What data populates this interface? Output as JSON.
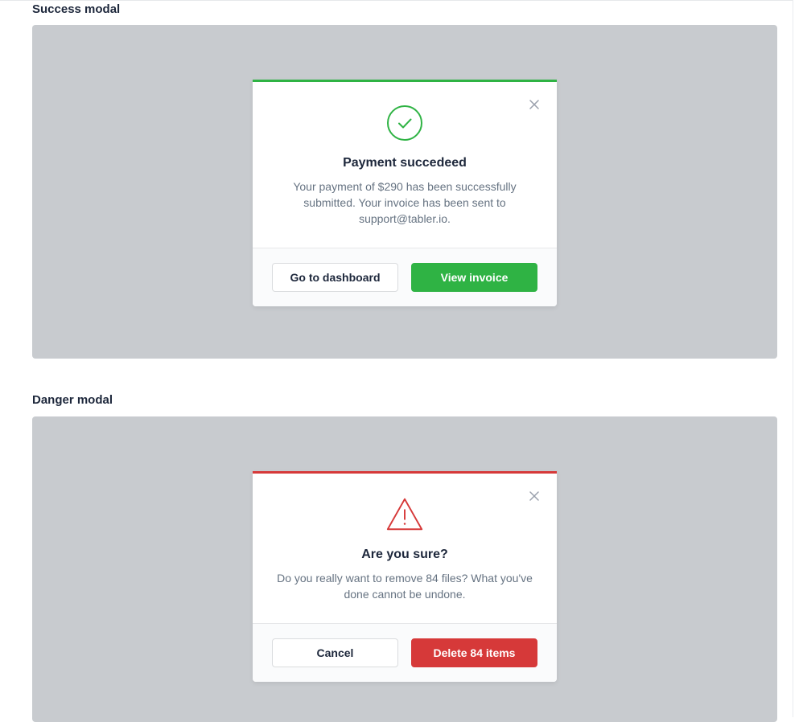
{
  "success_section": {
    "title": "Success modal",
    "modal": {
      "accent_color": "#2fb344",
      "icon": "circle-check-icon",
      "close_icon": "close-icon",
      "title": "Payment succedeed",
      "text": "Your payment of $290 has been successfully submitted. Your invoice has been sent to support@tabler.io.",
      "secondary_button": "Go to dashboard",
      "primary_button": "View invoice"
    }
  },
  "danger_section": {
    "title": "Danger modal",
    "modal": {
      "accent_color": "#d63939",
      "icon": "alert-triangle-icon",
      "close_icon": "close-icon",
      "title": "Are you sure?",
      "text": "Do you really want to remove 84 files? What you've done cannot be undone.",
      "secondary_button": "Cancel",
      "primary_button": "Delete 84 items"
    }
  },
  "colors": {
    "backdrop": "#c8cbcf",
    "success": "#2fb344",
    "danger": "#d63939"
  }
}
